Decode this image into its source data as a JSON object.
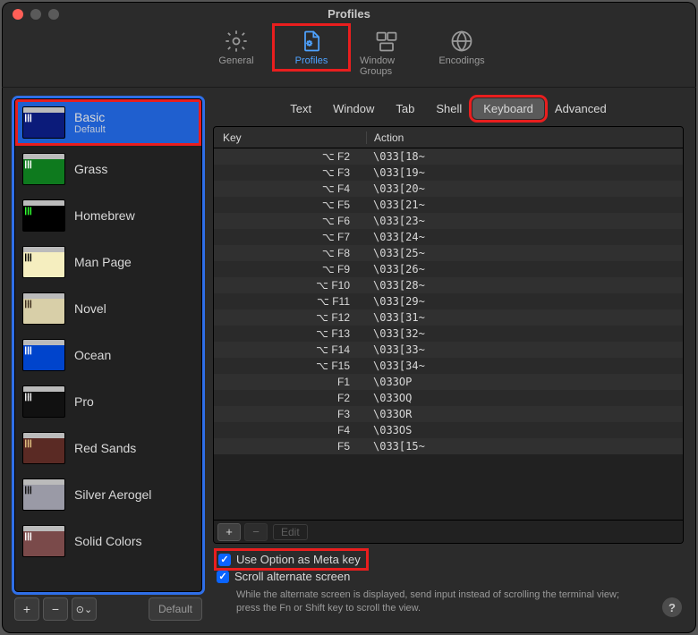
{
  "window": {
    "title": "Profiles"
  },
  "toolbar": {
    "items": [
      {
        "id": "general",
        "label": "General"
      },
      {
        "id": "profiles",
        "label": "Profiles",
        "active": true,
        "highlight": true
      },
      {
        "id": "window-groups",
        "label": "Window Groups"
      },
      {
        "id": "encodings",
        "label": "Encodings"
      }
    ]
  },
  "sidebar": {
    "profiles": [
      {
        "name": "Basic",
        "sub": "Default",
        "selected": true,
        "bg": "#0b1b7a",
        "fg": "#ffffff"
      },
      {
        "name": "Grass",
        "bg": "#0e7a1e",
        "fg": "#ffffff"
      },
      {
        "name": "Homebrew",
        "bg": "#000000",
        "fg": "#2fff2f"
      },
      {
        "name": "Man Page",
        "bg": "#f5eebf",
        "fg": "#000000"
      },
      {
        "name": "Novel",
        "bg": "#d8cfa8",
        "fg": "#3a2a1a"
      },
      {
        "name": "Ocean",
        "bg": "#0044cc",
        "fg": "#ffffff"
      },
      {
        "name": "Pro",
        "bg": "#111111",
        "fg": "#eeeeee"
      },
      {
        "name": "Red Sands",
        "bg": "#5a2a24",
        "fg": "#e0c080"
      },
      {
        "name": "Silver Aerogel",
        "bg": "#9a9aa6",
        "fg": "#111111"
      },
      {
        "name": "Solid Colors",
        "bg": "#7a4a4a",
        "fg": "#ffffff"
      }
    ],
    "footer": {
      "add": "+",
      "remove": "−",
      "menu": "⊙⌄",
      "default_label": "Default"
    }
  },
  "tabs": [
    {
      "label": "Text"
    },
    {
      "label": "Window"
    },
    {
      "label": "Tab"
    },
    {
      "label": "Shell"
    },
    {
      "label": "Keyboard",
      "active": true,
      "highlight": true
    },
    {
      "label": "Advanced"
    }
  ],
  "table": {
    "head": {
      "key": "Key",
      "action": "Action"
    },
    "rows": [
      {
        "key": "⌥ F2",
        "action": "\\033[18~"
      },
      {
        "key": "⌥ F3",
        "action": "\\033[19~"
      },
      {
        "key": "⌥ F4",
        "action": "\\033[20~"
      },
      {
        "key": "⌥ F5",
        "action": "\\033[21~"
      },
      {
        "key": "⌥ F6",
        "action": "\\033[23~"
      },
      {
        "key": "⌥ F7",
        "action": "\\033[24~"
      },
      {
        "key": "⌥ F8",
        "action": "\\033[25~"
      },
      {
        "key": "⌥ F9",
        "action": "\\033[26~"
      },
      {
        "key": "⌥ F10",
        "action": "\\033[28~"
      },
      {
        "key": "⌥ F11",
        "action": "\\033[29~"
      },
      {
        "key": "⌥ F12",
        "action": "\\033[31~"
      },
      {
        "key": "⌥ F13",
        "action": "\\033[32~"
      },
      {
        "key": "⌥ F14",
        "action": "\\033[33~"
      },
      {
        "key": "⌥ F15",
        "action": "\\033[34~"
      },
      {
        "key": "F1",
        "action": "\\033OP"
      },
      {
        "key": "F2",
        "action": "\\033OQ"
      },
      {
        "key": "F3",
        "action": "\\033OR"
      },
      {
        "key": "F4",
        "action": "\\033OS"
      },
      {
        "key": "F5",
        "action": "\\033[15~"
      }
    ],
    "footer": {
      "add": "+",
      "remove": "−",
      "edit": "Edit"
    }
  },
  "checks": {
    "meta": {
      "label": "Use Option as Meta key",
      "checked": true,
      "highlight": true
    },
    "scroll": {
      "label": "Scroll alternate screen",
      "checked": true
    }
  },
  "hint": "While the alternate screen is displayed, send input instead of scrolling the terminal view; press the Fn or Shift key to scroll the view.",
  "help": "?"
}
